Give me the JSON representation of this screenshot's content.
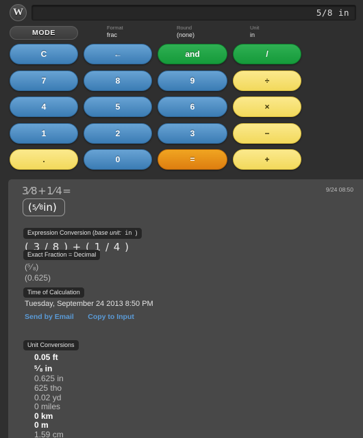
{
  "app": {
    "logo_text": "W"
  },
  "header": {
    "input_value": "5/8 in",
    "input_placeholder": ""
  },
  "modebar": {
    "mode_label": "MODE",
    "settings": [
      {
        "label": "Format",
        "value": "frac"
      },
      {
        "label": "Round",
        "value": "(none)"
      },
      {
        "label": "Unit",
        "value": "in"
      }
    ]
  },
  "keypad": {
    "rows": [
      [
        {
          "label": "C",
          "style": "blue"
        },
        {
          "label": "←",
          "style": "blue"
        },
        {
          "label": "and",
          "style": "green"
        },
        {
          "label": "/",
          "style": "green"
        }
      ],
      [
        {
          "label": "7",
          "style": "blue"
        },
        {
          "label": "8",
          "style": "blue"
        },
        {
          "label": "9",
          "style": "blue"
        },
        {
          "label": "÷",
          "style": "yellow"
        }
      ],
      [
        {
          "label": "4",
          "style": "blue"
        },
        {
          "label": "5",
          "style": "blue"
        },
        {
          "label": "6",
          "style": "blue"
        },
        {
          "label": "×",
          "style": "yellow"
        }
      ],
      [
        {
          "label": "1",
          "style": "blue"
        },
        {
          "label": "2",
          "style": "blue"
        },
        {
          "label": "3",
          "style": "blue"
        },
        {
          "label": "−",
          "style": "yellow"
        }
      ],
      [
        {
          "label": ".",
          "style": "yellow"
        },
        {
          "label": "0",
          "style": "blue"
        },
        {
          "label": "=",
          "style": "orange"
        },
        {
          "label": "+",
          "style": "yellow"
        }
      ]
    ]
  },
  "results": {
    "equation": "3⁄8+1⁄4=",
    "timestamp": "9/24 08:50",
    "result_prefix": "(",
    "result_numerator": "5",
    "result_denominator": "8",
    "result_unit": " in",
    "result_suffix": ")",
    "expression_conversion": {
      "tag_text": "Expression Conversion (",
      "tag_italic": "base unit:",
      "tag_unit": " in ",
      "tag_close": ")",
      "value": "( 3 / 8 ) + ( 1 / 4 )"
    },
    "exact_fraction": {
      "tag": "Exact Fraction = Decimal",
      "fraction_open": "(",
      "numerator": "5",
      "denominator": "8",
      "fraction_close": ")",
      "decimal": "(0.625)"
    },
    "time_of_calculation": {
      "tag": "Time of Calculation",
      "value": "Tuesday, September 24 2013 8:50 PM",
      "links": [
        {
          "label": "Send by Email"
        },
        {
          "label": "Copy to Input"
        }
      ]
    },
    "unit_conversions": {
      "tag": "Unit Conversions",
      "items": [
        {
          "text": "0.05 ft",
          "highlight": true
        },
        {
          "text": "",
          "highlight": true,
          "fraction": true,
          "numerator": "5",
          "denominator": "8",
          "unit": " in"
        },
        {
          "text": "0.625 in",
          "highlight": false
        },
        {
          "text": "625 tho",
          "highlight": false
        },
        {
          "text": "0.02 yd",
          "highlight": false
        },
        {
          "text": "0 miles",
          "highlight": false
        },
        {
          "text": "0 km",
          "highlight": true
        },
        {
          "text": "0 m",
          "highlight": true
        },
        {
          "text": "1.59 cm",
          "highlight": false
        }
      ]
    }
  },
  "colors": {
    "blue": "#4e8cc4",
    "green": "#1f9f3f",
    "yellow": "#f6e176",
    "orange": "#e8901a",
    "link": "#5a9ad6",
    "panel": "#484848",
    "background": "#2f2f2f"
  }
}
